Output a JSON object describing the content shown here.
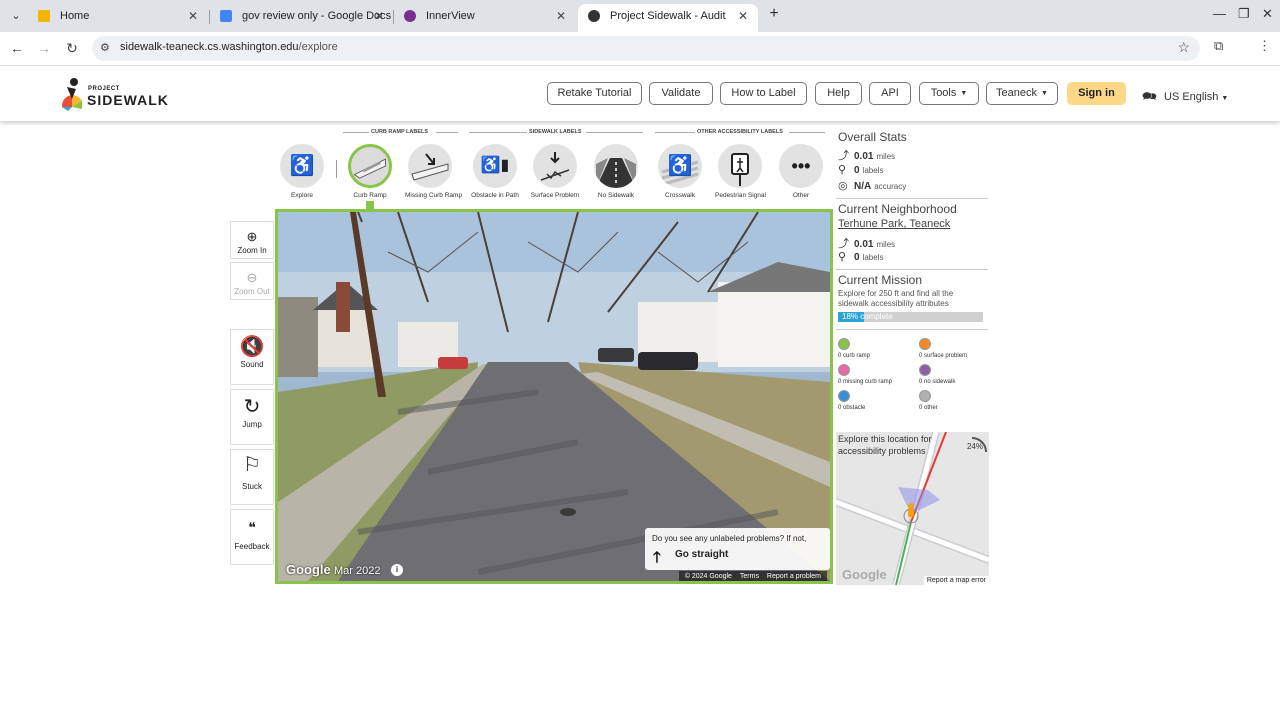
{
  "browser": {
    "tabs": [
      {
        "title": "Home",
        "favicon_color": "#f4b400"
      },
      {
        "title": "gov review only - Google Docs",
        "favicon_color": "#4285f4"
      },
      {
        "title": "InnerView",
        "favicon_color": "#7b2d8e"
      },
      {
        "title": "Project Sidewalk - Audit",
        "favicon_color": "#333333"
      }
    ],
    "url_host": "sidewalk-teaneck.cs.washington.edu",
    "url_path": "/explore"
  },
  "header": {
    "logo_project": "PROJECT",
    "logo_sidewalk": "SIDEWALK",
    "nav": [
      {
        "label": "Retake Tutorial"
      },
      {
        "label": "Validate"
      },
      {
        "label": "How to Label"
      },
      {
        "label": "Help"
      },
      {
        "label": "API"
      },
      {
        "label": "Tools"
      },
      {
        "label": "Teaneck"
      }
    ],
    "signin": "Sign in",
    "language": "US English"
  },
  "toolbar": {
    "groups": {
      "curb": "CURB RAMP LABELS",
      "sidewalk": "SIDEWALK LABELS",
      "other": "OTHER ACCESSIBILITY LABELS"
    },
    "tools": [
      {
        "label": "Explore",
        "icon": "wheelchair-icon"
      },
      {
        "label": "Curb Ramp",
        "icon": "curb-ramp-icon",
        "selected": true
      },
      {
        "label": "Missing Curb Ramp",
        "icon": "missing-curb-ramp-icon"
      },
      {
        "label": "Obstacle in Path",
        "icon": "obstacle-icon"
      },
      {
        "label": "Surface Problem",
        "icon": "surface-problem-icon"
      },
      {
        "label": "No Sidewalk",
        "icon": "no-sidewalk-icon"
      },
      {
        "label": "Crosswalk",
        "icon": "crosswalk-icon"
      },
      {
        "label": "Pedestrian Signal",
        "icon": "pedestrian-signal-icon"
      },
      {
        "label": "Other",
        "icon": "more-icon"
      }
    ]
  },
  "controls": {
    "zoom_in": "Zoom In",
    "zoom_out": "Zoom Out",
    "sound": "Sound",
    "jump": "Jump",
    "stuck": "Stuck",
    "feedback": "Feedback"
  },
  "streetview": {
    "google": "Google",
    "date": "Mar 2022",
    "attribution": [
      "© 2024 Google",
      "Terms",
      "Report a problem"
    ],
    "prompt_question": "Do you see any unlabeled problems? If not,",
    "prompt_action": "Go straight"
  },
  "status": {
    "overall": {
      "title": "Overall Stats",
      "miles": "0.01",
      "miles_unit": "miles",
      "labels": "0",
      "labels_unit": "labels",
      "accuracy": "N/A",
      "accuracy_unit": "accuracy"
    },
    "neighborhood": {
      "title": "Current Neighborhood",
      "name": "Terhune Park, Teaneck",
      "miles": "0.01",
      "miles_unit": "miles",
      "labels": "0",
      "labels_unit": "labels"
    },
    "mission": {
      "title": "Current Mission",
      "description": "Explore for 250 ft and find all the sidewalk accessibility attributes",
      "progress_text": "18% complete",
      "progress": 0.18
    },
    "counts": [
      {
        "text": "0 curb ramp",
        "color": "#88c34a"
      },
      {
        "text": "0 surface problem",
        "color": "#f08a24"
      },
      {
        "text": "0 missing curb ramp",
        "color": "#e66aa8"
      },
      {
        "text": "0 no sidewalk",
        "color": "#8e5fa8"
      },
      {
        "text": "0 obstacle",
        "color": "#3a8fd6"
      },
      {
        "text": "0 other",
        "color": "#b0b0b0"
      }
    ]
  },
  "minimap": {
    "message": "Explore this location for accessibility problems",
    "percent": "24%",
    "google": "Google",
    "report": "Report a map error"
  },
  "colors": {
    "accent_green": "#88c34a",
    "signin_yellow": "#fdd888",
    "progress_blue": "#2ba4d8"
  }
}
